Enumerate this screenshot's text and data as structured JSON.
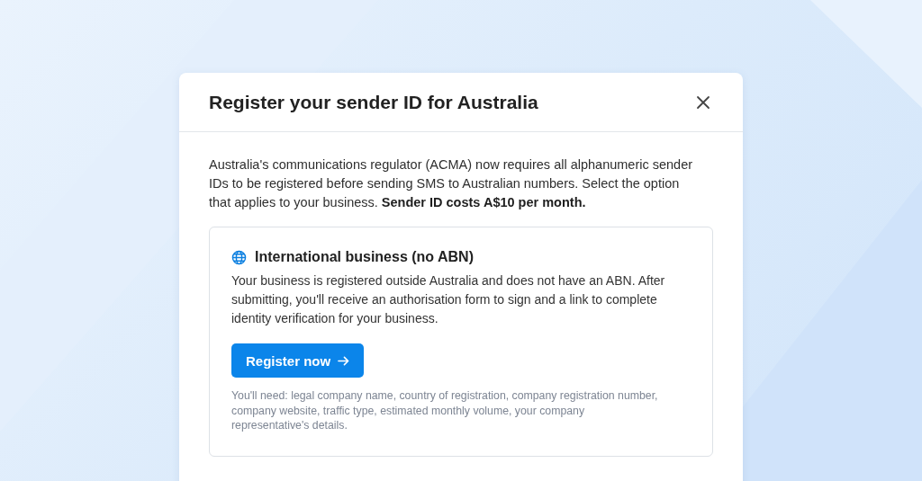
{
  "dialog": {
    "title": "Register your sender ID for Australia",
    "intro": "Australia's communications regulator (ACMA) now requires all alphanumeric sender IDs to be registered before sending SMS to Australian numbers. Select the option that applies to your business. **Sender ID costs A$10 per month.**",
    "option": {
      "title": "International business (no ABN)",
      "description": "Your business is registered outside Australia and does not have an ABN. After submitting, you'll receive an authorisation form to sign and a link to complete identity verification for your business.",
      "button": "Register now",
      "note": "You'll need: legal company name, country of registration, company registration number, company website, traffic type, estimated monthly volume, your company representative's details."
    }
  }
}
